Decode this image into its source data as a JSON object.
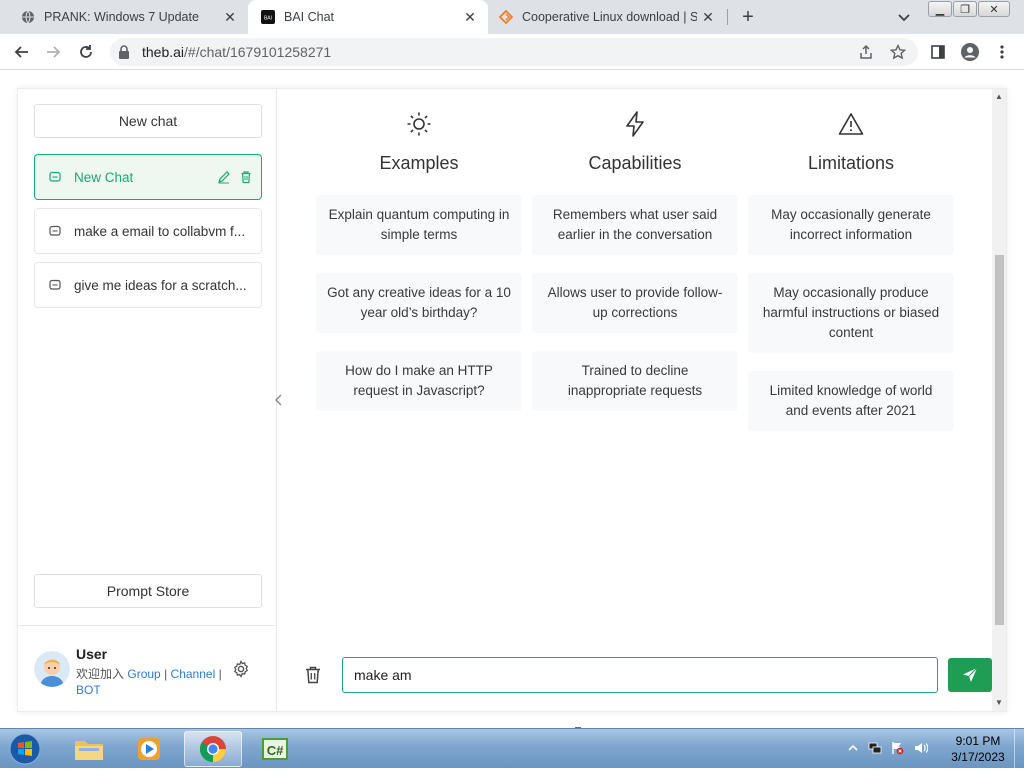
{
  "browser": {
    "tabs": [
      {
        "title": "PRANK: Windows 7 Update",
        "favicon": "globe-icon",
        "active": false
      },
      {
        "title": "BAI Chat",
        "favicon": "bai-logo-icon",
        "active": true
      },
      {
        "title": "Cooperative Linux download | So",
        "favicon": "sourceforge-icon",
        "active": false
      }
    ],
    "url_host": "theb.ai",
    "url_path": "/#/chat/1679101258271"
  },
  "sidebar": {
    "new_chat_label": "New chat",
    "chats": [
      {
        "label": "New Chat",
        "active": true
      },
      {
        "label": "make a email to collabvm f...",
        "active": false
      },
      {
        "label": "give me ideas for a scratch...",
        "active": false
      }
    ],
    "prompt_store_label": "Prompt Store",
    "user": {
      "name": "User",
      "welcome": "欢迎加入",
      "group": "Group",
      "sep1": "|",
      "channel": "Channel",
      "sep2": "|",
      "bot": "BOT"
    }
  },
  "main": {
    "columns": [
      {
        "title": "Examples",
        "icon": "sun-icon",
        "items": [
          "Explain quantum computing in simple terms",
          "Got any creative ideas for a 10 year old’s birthday?",
          "How do I make an HTTP request in Javascript?"
        ]
      },
      {
        "title": "Capabilities",
        "icon": "lightning-icon",
        "items": [
          "Remembers what user said earlier in the conversation",
          "Allows user to provide follow-up corrections",
          "Trained to decline inappropriate requests"
        ]
      },
      {
        "title": "Limitations",
        "icon": "warning-icon",
        "items": [
          "May occasionally generate incorrect information",
          "May occasionally produce harmful instructions or biased content",
          "Limited knowledge of world and events after 2021"
        ]
      }
    ],
    "input_value": "make am"
  },
  "taskbar": {
    "time": "9:01 PM",
    "date": "3/17/2023"
  },
  "colors": {
    "accent": "#19a974",
    "send": "#1f9d55",
    "card": "#f7f9fa"
  }
}
